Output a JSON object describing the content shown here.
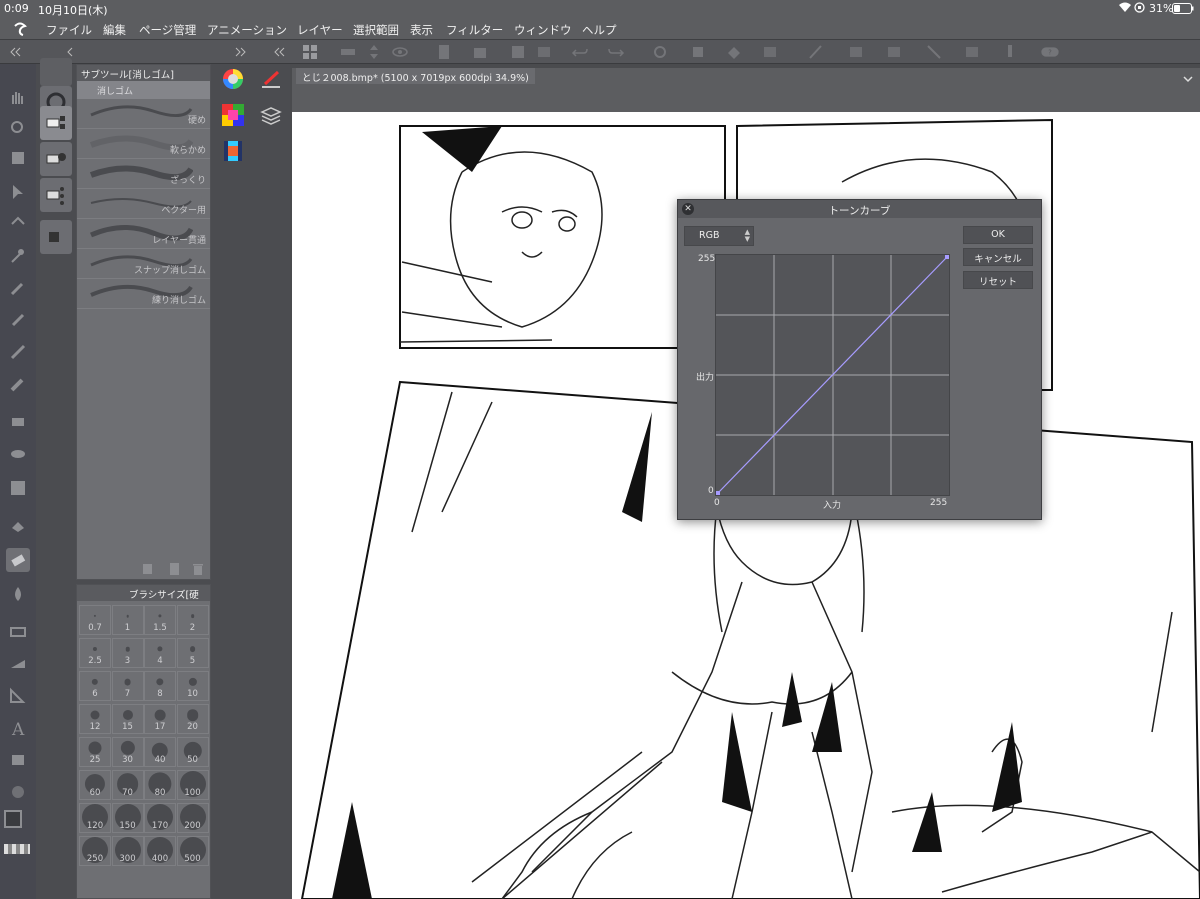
{
  "status_bar": {
    "time": "0:09",
    "date": "10月10日(木)",
    "battery": "31%"
  },
  "menu": {
    "items": [
      "ファイル",
      "編集",
      "ページ管理",
      "アニメーション",
      "レイヤー",
      "選択範囲",
      "表示",
      "フィルター",
      "ウィンドウ",
      "ヘルプ"
    ]
  },
  "subtool_panel": {
    "title": "サブツール[消しゴム]",
    "group": "消しゴム",
    "brushes": [
      "硬め",
      "軟らかめ",
      "ざっくり",
      "ベクター用",
      "レイヤー貫通",
      "スナップ消しゴム",
      "練り消しゴム"
    ]
  },
  "brush_size_panel": {
    "title": "ブラシサイズ[硬",
    "sizes": [
      "0.7",
      "1",
      "1.5",
      "2",
      "2.5",
      "3",
      "4",
      "5",
      "6",
      "7",
      "8",
      "10",
      "12",
      "15",
      "17",
      "20",
      "25",
      "30",
      "40",
      "50",
      "60",
      "70",
      "80",
      "100",
      "120",
      "150",
      "170",
      "200",
      "250",
      "300",
      "400",
      "500"
    ]
  },
  "document": {
    "tab_title": "とじ２008.bmp* (5100 x 7019px 600dpi 34.9%)"
  },
  "tone_curve_dialog": {
    "title": "トーンカーブ",
    "channel": "RGB",
    "ok_label": "OK",
    "cancel_label": "キャンセル",
    "reset_label": "リセット",
    "y_max": "255",
    "y_mid_label": "出力",
    "y_min": "0",
    "x_min": "0",
    "x_mid_label": "入力",
    "x_max": "255",
    "curve_color": "#a79cff"
  },
  "colors": {
    "ui_bg": "#4b4c50",
    "panel_bg": "#6e6f73",
    "accent": "#a79cff"
  }
}
